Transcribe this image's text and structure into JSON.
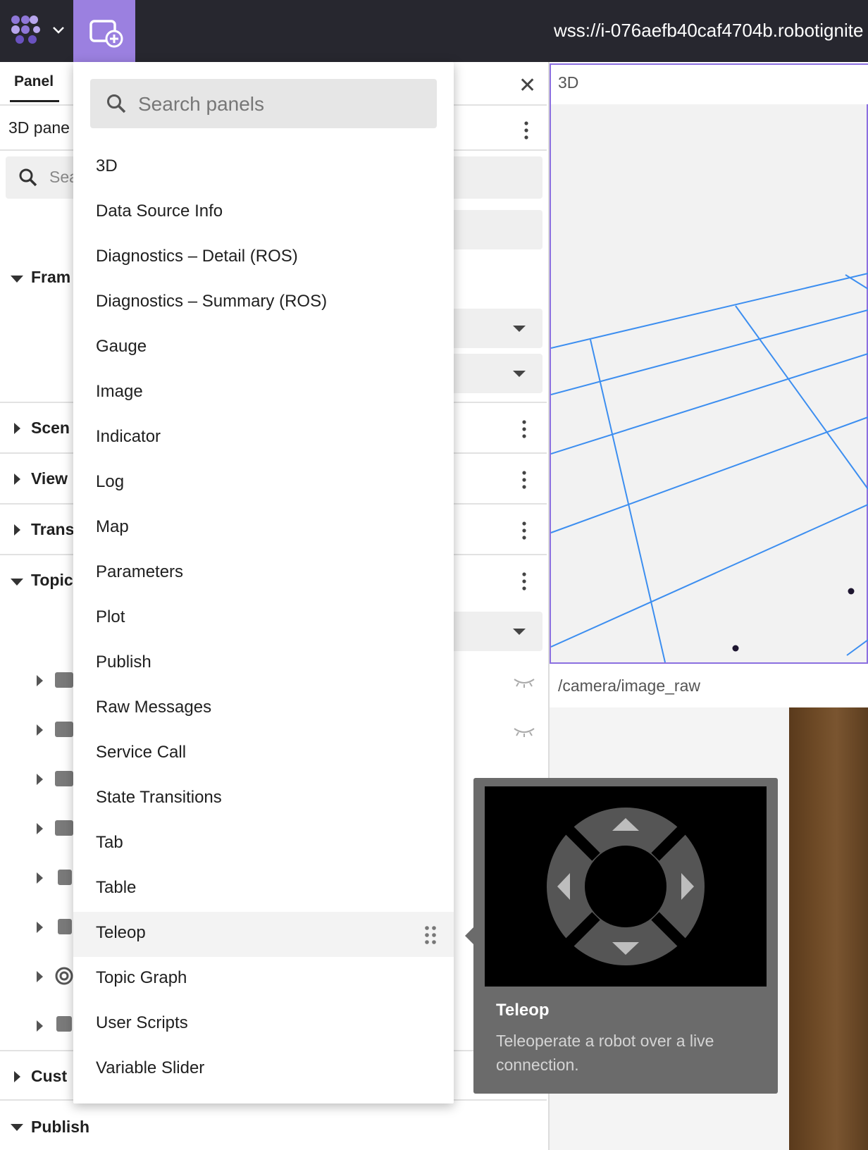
{
  "topbar": {
    "connection_url": "wss://i-076aefb40caf4704b.robotignite"
  },
  "settings_panel": {
    "tab_label": "Panel",
    "title": "3D pane",
    "search_placeholder": "Sea",
    "sections": [
      {
        "label": "Fram",
        "expanded": true
      },
      {
        "label": "Scen",
        "expanded": false
      },
      {
        "label": "View",
        "expanded": false
      },
      {
        "label": "Trans",
        "expanded": false
      },
      {
        "label": "Topic",
        "expanded": true
      },
      {
        "label": "Cust",
        "expanded": false
      },
      {
        "label": "Publish",
        "expanded": true
      }
    ]
  },
  "panels": {
    "three_d_title": "3D",
    "image_title": "/camera/image_raw"
  },
  "add_panel_menu": {
    "search_placeholder": "Search panels",
    "items": [
      "3D",
      "Data Source Info",
      "Diagnostics – Detail (ROS)",
      "Diagnostics – Summary (ROS)",
      "Gauge",
      "Image",
      "Indicator",
      "Log",
      "Map",
      "Parameters",
      "Plot",
      "Publish",
      "Raw Messages",
      "Service Call",
      "State Transitions",
      "Tab",
      "Table",
      "Teleop",
      "Topic Graph",
      "User Scripts",
      "Variable Slider"
    ],
    "highlighted_item": "Teleop"
  },
  "tooltip": {
    "title": "Teleop",
    "description": "Teleoperate a robot over a live connection."
  },
  "colors": {
    "topbar_bg": "#27272f",
    "accent": "#9b80e0",
    "grid_line": "#3c8ef0",
    "tooltip_bg": "#6b6b6b"
  },
  "icons": {
    "logo": "foxglove-logo-icon",
    "add_panel": "add-panel-icon",
    "search": "search-icon",
    "drag": "drag-handle-icon",
    "close": "close-icon"
  }
}
